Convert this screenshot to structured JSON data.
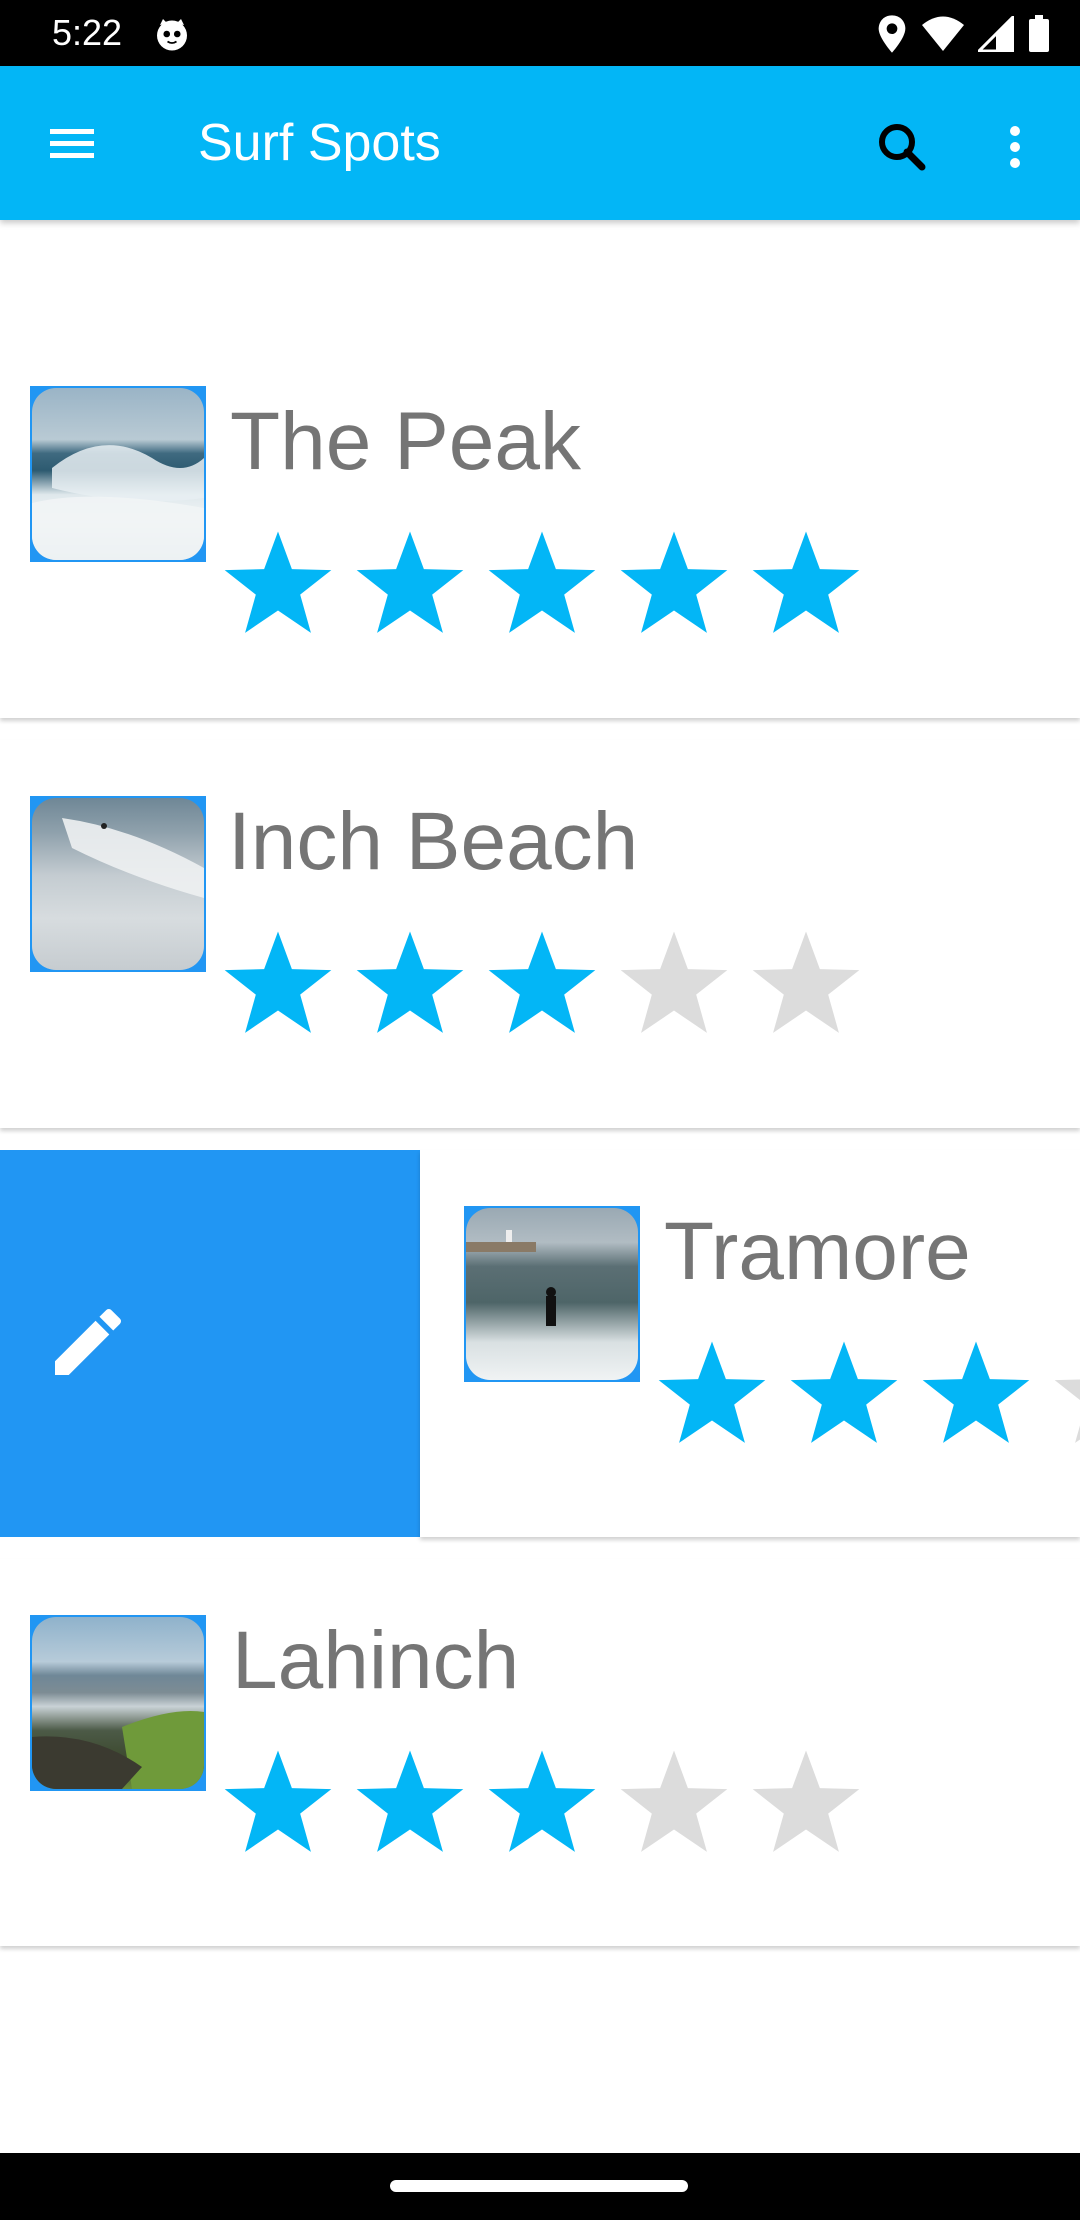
{
  "status_bar": {
    "time": "5:22",
    "icons": [
      "cat-icon",
      "location-icon",
      "wifi-icon",
      "signal-icon",
      "battery-icon"
    ]
  },
  "app_bar": {
    "title": "Surf Spots",
    "menu_icon": "menu-icon",
    "search_icon": "search-icon",
    "more_icon": "more-vert-icon",
    "background": "#03b6f6"
  },
  "colors": {
    "star_filled": "#03b6f6",
    "star_empty": "#dcdcdc",
    "thumb_border": "#2196f3",
    "edit_panel": "#2196f3",
    "name_text": "#757575"
  },
  "spots": [
    {
      "name": "The Peak",
      "rating": 5,
      "max_rating": 5
    },
    {
      "name": "Inch Beach",
      "rating": 3,
      "max_rating": 5
    },
    {
      "name": "Tramore",
      "rating": 3,
      "max_rating": 5,
      "swipe_action": "edit-icon"
    },
    {
      "name": "Lahinch",
      "rating": 3,
      "max_rating": 5
    }
  ]
}
